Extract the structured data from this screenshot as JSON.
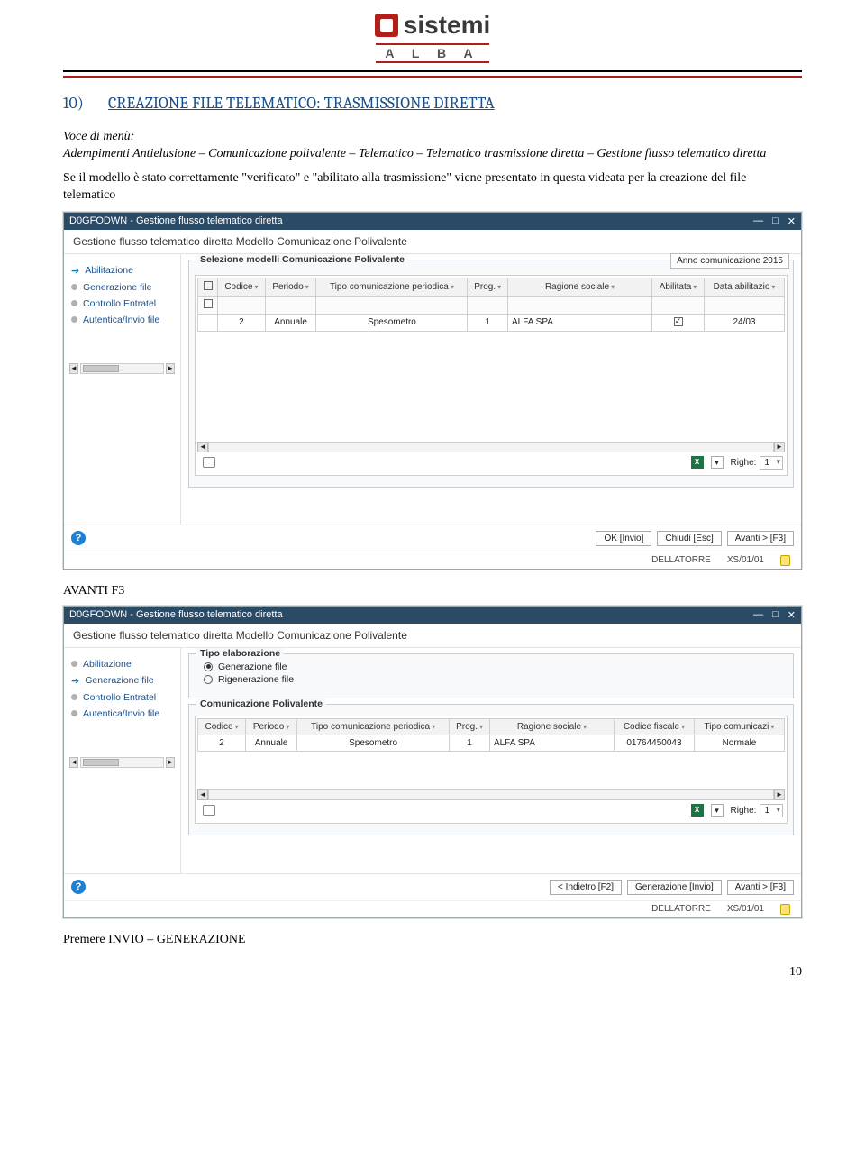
{
  "logo": {
    "brand": "sistemi",
    "sub": "A L B A"
  },
  "section": {
    "num": "10)",
    "label": "CREAZIONE FILE TELEMATICO: TRASMISSIONE DIRETTA"
  },
  "text": {
    "voce": "Voce di menù:",
    "path": "Adempimenti Antielusione – Comunicazione polivalente – Telematico – Telematico trasmissione diretta – Gestione flusso telematico diretta",
    "body": "Se il modello è stato correttamente \"verificato\" e \"abilitato alla trasmissione\" viene presentato in questa videata per la creazione del file telematico",
    "avanti": "AVANTI F3",
    "footer": "Premere INVIO – GENERAZIONE",
    "pagenum": "10"
  },
  "window": {
    "title": "D0GFODWN - Gestione flusso telematico diretta",
    "subheader": "Gestione flusso telematico diretta Modello Comunicazione Polivalente",
    "sidebar": [
      "Abilitazione",
      "Generazione file",
      "Controllo Entratel",
      "Autentica/Invio file"
    ]
  },
  "radio": {
    "group": "Tipo elaborazione",
    "opt1": "Generazione file",
    "opt2": "Rigenerazione file"
  },
  "grid1": {
    "group": "Selezione modelli Comunicazione Polivalente",
    "anno": "Anno comunicazione 2015",
    "headers": [
      "",
      "Codice",
      "Periodo",
      "Tipo comunicazione periodica",
      "Prog.",
      "Ragione sociale",
      "Abilitata",
      "Data abilitazio"
    ],
    "row": {
      "codice": "2",
      "periodo": "Annuale",
      "tipo": "Spesometro",
      "prog": "1",
      "rs": "ALFA SPA",
      "data": "24/03"
    }
  },
  "grid2": {
    "group": "Comunicazione Polivalente",
    "headers": [
      "Codice",
      "Periodo",
      "Tipo comunicazione periodica",
      "Prog.",
      "Ragione sociale",
      "Codice fiscale",
      "Tipo comunicazi"
    ],
    "row": {
      "codice": "2",
      "periodo": "Annuale",
      "tipo": "Spesometro",
      "prog": "1",
      "rs": "ALFA SPA",
      "cf": "01764450043",
      "tcom": "Normale"
    }
  },
  "gridfoot": {
    "righe_lbl": "Righe:",
    "righe_val": "1"
  },
  "buttons": {
    "ok": "OK [Invio]",
    "chiudi": "Chiudi [Esc]",
    "avanti": "Avanti > [F3]",
    "indietro": "< Indietro [F2]",
    "generazione": "Generazione [Invio]"
  },
  "status": {
    "user": "DELLATORRE",
    "code": "XS/01/01"
  }
}
